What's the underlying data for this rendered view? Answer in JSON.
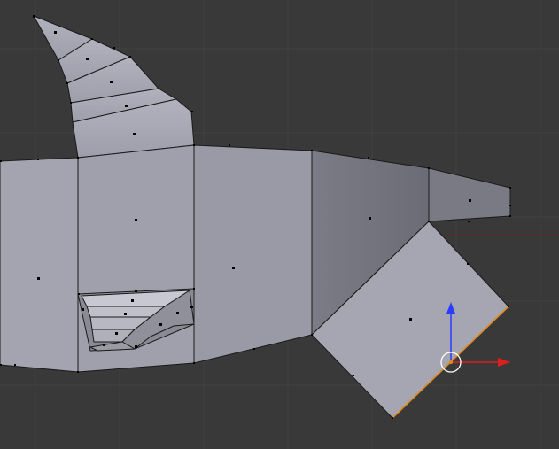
{
  "viewport": {
    "editor": "3d-viewport",
    "mode": "face-select",
    "mesh_object": "fish-mesh",
    "selected_face": "pectoral-fin-face",
    "grid_visible": true,
    "active_manipulator": "translate-gizmo",
    "colors": {
      "background": "#393939",
      "grid_line": "#414141",
      "mesh_face_light": "#a8a8b4",
      "mesh_face_mid": "#9a9aa6",
      "mesh_face_dark": "#6e6e78",
      "mesh_edge": "#1a1a1a",
      "selected_edge": "#e08a20",
      "face_dot": "#000000",
      "axis_x": "#dd1e1e",
      "axis_z": "#2a3cff",
      "x_axis_line": "#7a1f1f",
      "cursor": "#ffffff"
    }
  },
  "gizmo": {
    "x_axis_color": "#dd1e1e",
    "z_axis_color": "#2a3cff",
    "center_ring": "white"
  }
}
